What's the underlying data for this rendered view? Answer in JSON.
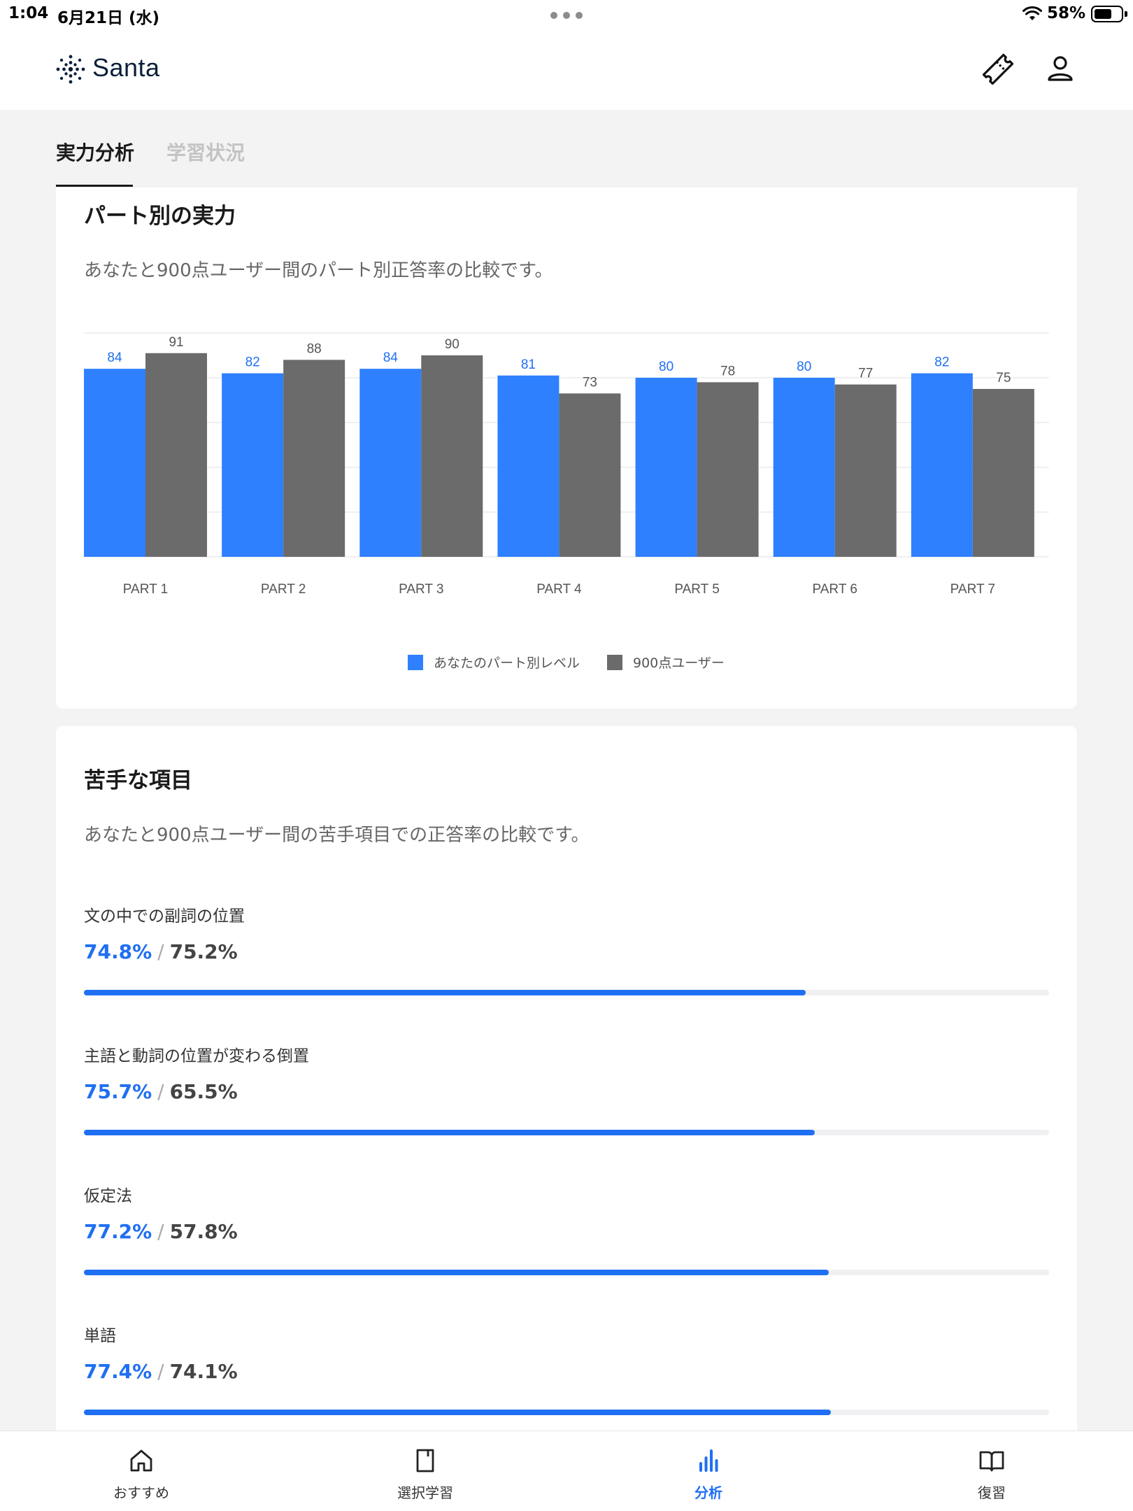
{
  "status_bar": {
    "time": "1:04",
    "date": "6月21日 (水)",
    "battery": "58%"
  },
  "header": {
    "logo_text": "Santa",
    "icons": [
      "logo-dots-icon",
      "ticket-icon",
      "profile-icon"
    ]
  },
  "tabs": [
    {
      "label": "実力分析",
      "active": true
    },
    {
      "label": "学習状況",
      "active": false
    }
  ],
  "parts_card": {
    "title": "パート別の実力",
    "description": "あなたと900点ユーザー間のパート別正答率の比較です。"
  },
  "chart_data": {
    "type": "bar",
    "categories": [
      "PART 1",
      "PART 2",
      "PART 3",
      "PART 4",
      "PART 5",
      "PART 6",
      "PART 7"
    ],
    "series": [
      {
        "name": "あなたのパート別レベル",
        "values": [
          84,
          82,
          84,
          81,
          80,
          80,
          82
        ],
        "color": "#2f80ff"
      },
      {
        "name": "900点ユーザー",
        "values": [
          91,
          88,
          90,
          73,
          78,
          77,
          75
        ],
        "color": "#6b6b6b"
      }
    ],
    "ylim": [
      0,
      100
    ],
    "grid": true,
    "legend": "bottom-center"
  },
  "weak_card": {
    "title": "苦手な項目",
    "description": "あなたと900点ユーザー間の苦手項目での正答率の比較です。",
    "separator": "/",
    "items": [
      {
        "name": "文の中での副詞の位置",
        "you": "74.8%",
        "top": "75.2%",
        "progress": 0.748
      },
      {
        "name": "主語と動詞の位置が変わる倒置",
        "you": "75.7%",
        "top": "65.5%",
        "progress": 0.757
      },
      {
        "name": "仮定法",
        "you": "77.2%",
        "top": "57.8%",
        "progress": 0.772
      },
      {
        "name": "単語",
        "you": "77.4%",
        "top": "74.1%",
        "progress": 0.774
      }
    ]
  },
  "bottom_nav": [
    {
      "label": "おすすめ",
      "icon": "home-icon",
      "active": false
    },
    {
      "label": "選択学習",
      "icon": "book-icon",
      "active": false
    },
    {
      "label": "分析",
      "icon": "bar-chart-icon",
      "active": true
    },
    {
      "label": "復習",
      "icon": "open-book-icon",
      "active": false
    }
  ],
  "colors": {
    "accent": "#1f6ff2",
    "bar_you": "#2f80ff",
    "bar_top": "#6b6b6b",
    "background": "#f3f3f4"
  }
}
